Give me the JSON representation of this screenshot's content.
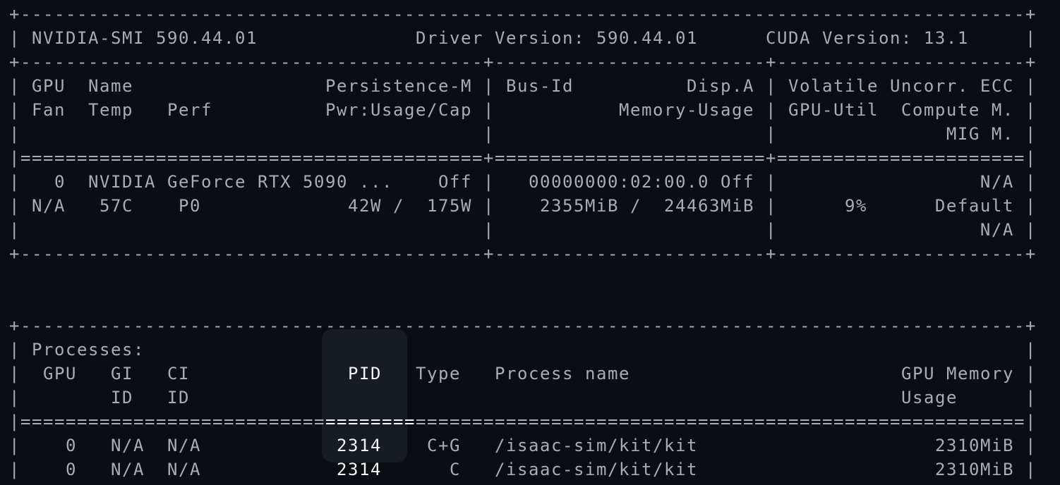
{
  "lines": [
    "+-----------------------------------------------------------------------------------------+",
    "| NVIDIA-SMI 590.44.01              Driver Version: 590.44.01      CUDA Version: 13.1     |",
    "+-----------------------------------------+------------------------+----------------------+",
    "| GPU  Name                 Persistence-M | Bus-Id          Disp.A | Volatile Uncorr. ECC |",
    "| Fan  Temp   Perf          Pwr:Usage/Cap |           Memory-Usage | GPU-Util  Compute M. |",
    "|                                         |                        |               MIG M. |",
    "|=========================================+========================+======================|",
    "|   0  NVIDIA GeForce RTX 5090 ...    Off |   00000000:02:00.0 Off |                  N/A |",
    "| N/A   57C    P0             42W /  175W |    2355MiB /  24463MiB |      9%      Default |",
    "|                                         |                        |                  N/A |",
    "+-----------------------------------------+------------------------+----------------------+",
    "",
    "",
    "+-----------------------------------------------------------------------------------------+",
    "| Processes:                                                                              |",
    "|  GPU   GI   CI              PID   Type   Process name                        GPU Memory |",
    "|        ID   ID                                                               Usage      |",
    "|=========================================================================================|",
    "|    0   N/A  N/A            2314    C+G   /isaac-sim/kit/kit                     2310MiB |",
    "|    0   N/A  N/A            2314      C   /isaac-sim/kit/kit                     2310MiB |",
    "+-----------------------------------------------------------------------------------------+"
  ],
  "highlight": {
    "column_header": "PID",
    "rows": [
      "2314",
      "2314"
    ]
  }
}
